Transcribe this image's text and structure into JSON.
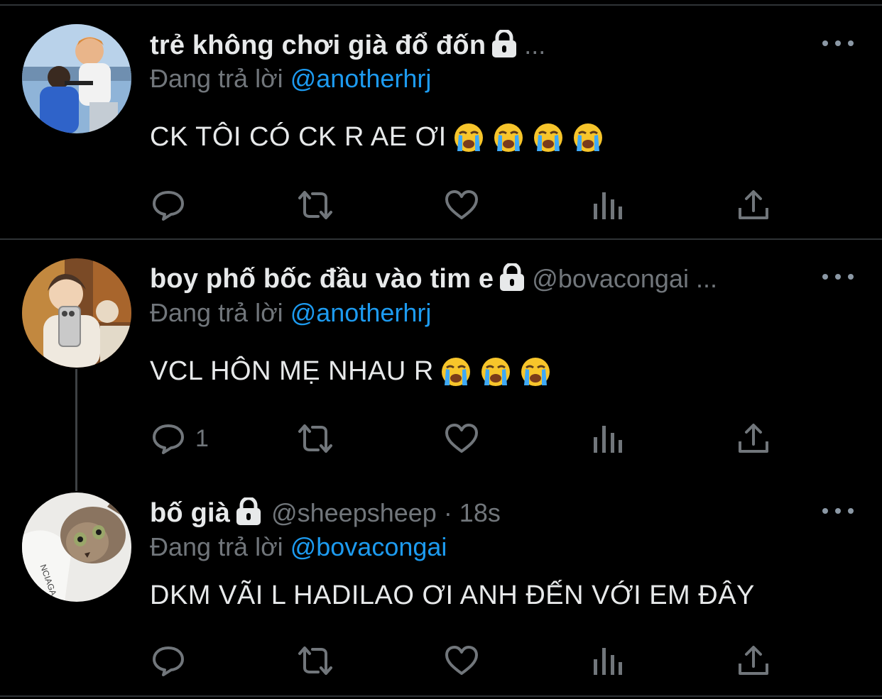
{
  "colors": {
    "background": "#000000",
    "text": "#e7e9ea",
    "muted": "#71767b",
    "link": "#1d9bf0",
    "divider": "#2f3336"
  },
  "tweets": [
    {
      "name": "trẻ không chơi già đổ đốn",
      "handle": "",
      "handle_suffix": "...",
      "time": "",
      "reply_label": "Đang trả lời",
      "reply_mention": "@anotherhrj",
      "text": "CK TÔI CÓ CK R AE ƠI",
      "emoji_count": 4,
      "emoji_name": "loudly-crying-face",
      "reply_count": ""
    },
    {
      "name": "boy phố bốc đầu vào tim e",
      "handle": "@bovacongai ...",
      "time": "",
      "reply_label": "Đang trả lời",
      "reply_mention": "@anotherhrj",
      "text": "VCL HÔN MẸ NHAU R",
      "emoji_count": 3,
      "emoji_name": "loudly-crying-face",
      "reply_count": "1"
    },
    {
      "name": "bố già",
      "handle": "@sheepsheep · 18s",
      "time": "",
      "reply_label": "Đang trả lời",
      "reply_mention": "@bovacongai",
      "text": "DKM VÃI L HADILAO ƠI ANH ĐẾN VỚI EM ĐÂY",
      "emoji_count": 0,
      "reply_count": ""
    }
  ],
  "icons": {
    "lock": "lock-icon",
    "more": "more-dots-icon",
    "reply": "reply-bubble-icon",
    "retweet": "retweet-icon",
    "like": "heart-icon",
    "views": "analytics-bars-icon",
    "share": "share-upload-icon"
  }
}
